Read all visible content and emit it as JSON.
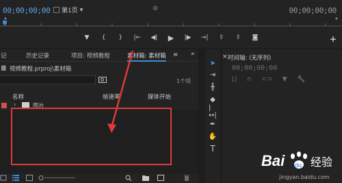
{
  "monitor": {
    "timecode_left": "00;00;00;00",
    "timecode_right": "00;00;00;00",
    "zoom_label": "第1页",
    "transport_icons": [
      "marker-icon",
      "mark-in-icon",
      "mark-out-icon",
      "go-to-in-icon",
      "step-back-icon",
      "play-icon",
      "step-forward-icon",
      "go-to-out-icon",
      "lift-icon",
      "extract-icon",
      "export-frame-icon"
    ],
    "add_label": "+"
  },
  "project": {
    "tabs": [
      "记",
      "历史记录",
      "项目: 视频教程",
      "素材箱: 素材箱"
    ],
    "bin_path": "视频教程.prproj\\素材箱",
    "item_count": "1个项",
    "columns": {
      "name": "名称",
      "frame_rate": "帧速率",
      "media_start": "媒体开始"
    },
    "rows": [
      {
        "name": "图片"
      }
    ]
  },
  "timeline": {
    "title": "时间轴: (无序列)",
    "timecode": "00;00;00;00"
  },
  "watermark": {
    "brand": "Bai",
    "brand2": "经验",
    "url": "jingyan.baidu.com"
  },
  "colors": {
    "accent_blue": "#3d8fd9",
    "annotation_red": "#e03a3a"
  }
}
